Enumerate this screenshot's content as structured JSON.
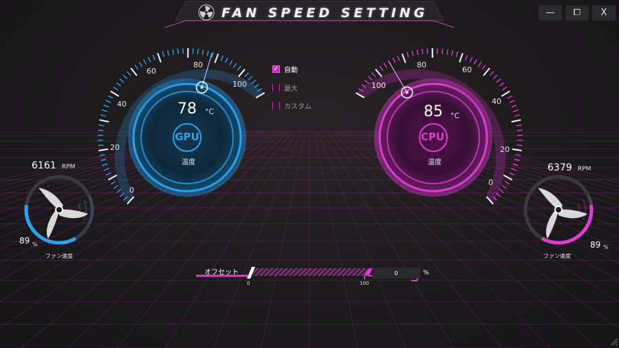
{
  "app": {
    "title": "FAN SPEED SETTING"
  },
  "window_controls": {
    "minimize": "—",
    "maximize": "⧠",
    "close": "X"
  },
  "colors": {
    "gpu_accent": "#2aa3f0",
    "cpu_accent": "#e03bd4",
    "background": "#1c1a1c"
  },
  "gpu": {
    "label": "GPU",
    "temperature": "78",
    "temperature_value": 78,
    "temp_unit": "°C",
    "temp_caption": "温度",
    "dial_numbers": [
      "0",
      "20",
      "40",
      "60",
      "80",
      "100"
    ],
    "fan": {
      "rpm": "6161",
      "rpm_unit": "RPM",
      "percent": "89",
      "percent_value": 89,
      "percent_unit": "%",
      "caption": "ファン速度"
    }
  },
  "cpu": {
    "label": "CPU",
    "temperature": "85",
    "temperature_value": 85,
    "temp_unit": "°C",
    "temp_caption": "温度",
    "dial_numbers": [
      "0",
      "20",
      "40",
      "60",
      "80",
      "100"
    ],
    "fan": {
      "rpm": "6379",
      "rpm_unit": "RPM",
      "percent": "89",
      "percent_value": 89,
      "percent_unit": "%",
      "caption": "ファン速度"
    }
  },
  "modes": [
    {
      "label": "自動",
      "checked": true
    },
    {
      "label": "最大",
      "checked": false
    },
    {
      "label": "カスタム",
      "checked": false
    }
  ],
  "offset": {
    "label": "オフセット",
    "min_label": "0",
    "max_label": "100",
    "value": "0",
    "value_fraction": 0.0,
    "unit": "%"
  }
}
